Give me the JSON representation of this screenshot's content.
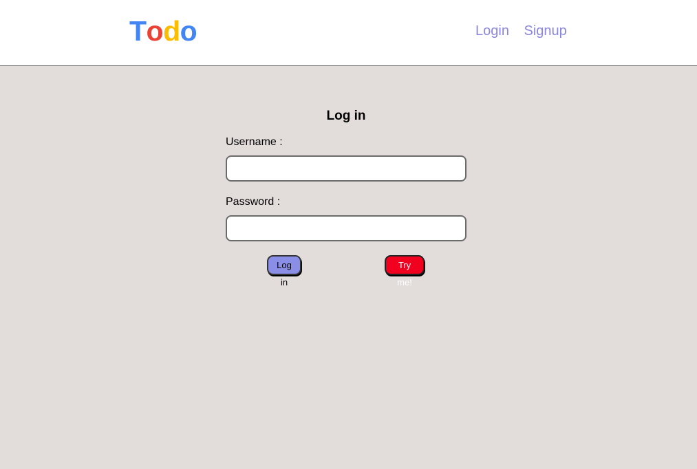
{
  "navbar": {
    "logo": {
      "letters": [
        {
          "char": "T",
          "color": "#4285f4"
        },
        {
          "char": "o",
          "color": "#ea4335"
        },
        {
          "char": "d",
          "color": "#fbbc05"
        },
        {
          "char": "o",
          "color": "#4285f4"
        }
      ]
    },
    "links": {
      "login": "Login",
      "signup": "Signup"
    },
    "link_color": "#8b86df"
  },
  "login_form": {
    "title": "Log in",
    "username_label": "Username :",
    "username_value": "",
    "password_label": "Password :",
    "password_value": "",
    "login_button": "Log in",
    "try_button": "Try me!"
  },
  "colors": {
    "background": "#e2dcdb",
    "login_button_bg": "#8a8ee6",
    "try_button_bg": "#f2001f"
  }
}
